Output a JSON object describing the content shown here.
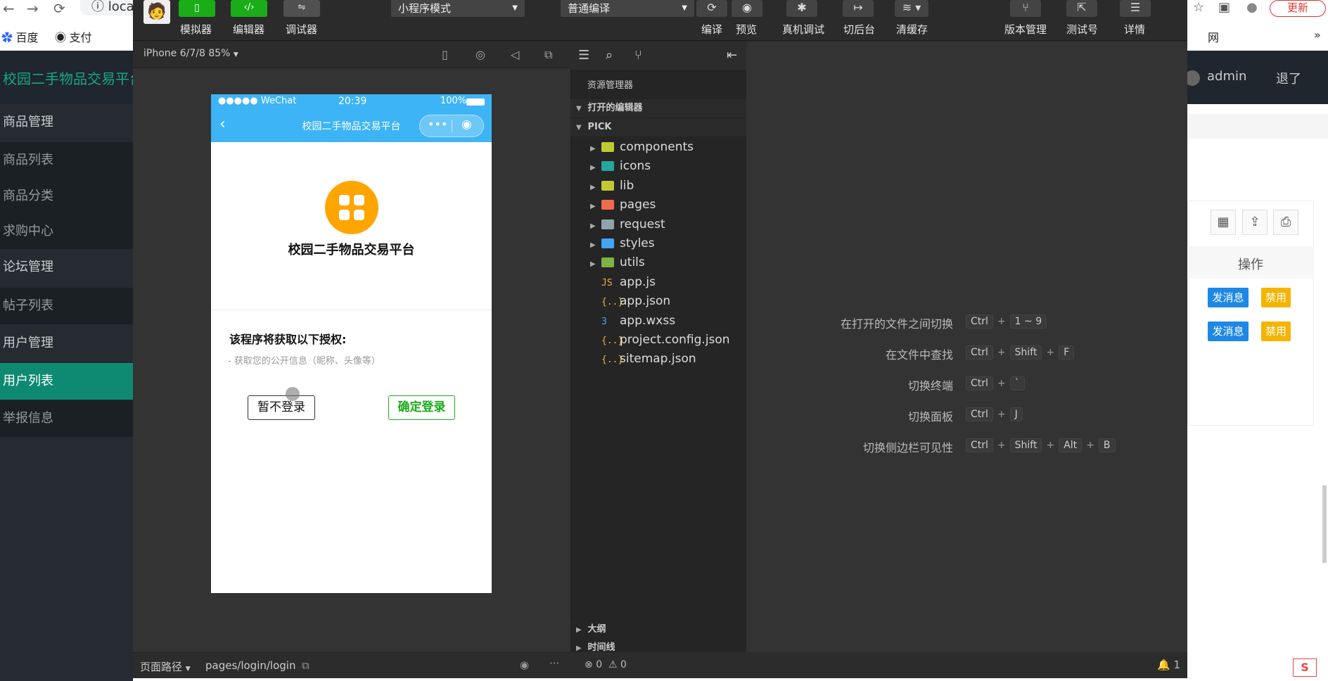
{
  "browser": {
    "url_text": "loca",
    "bookmarks": [
      "百度",
      "支付"
    ],
    "extension_text": "网",
    "update_label": "更新"
  },
  "admin": {
    "title": "校园二手物品交易平台",
    "user": "admin",
    "logout": "退了",
    "sidebar": [
      {
        "label": "商品管理",
        "kind": "group"
      },
      {
        "label": "商品列表",
        "kind": "sub"
      },
      {
        "label": "商品分类",
        "kind": "sub"
      },
      {
        "label": "求购中心",
        "kind": "sub"
      },
      {
        "label": "论坛管理",
        "kind": "group"
      },
      {
        "label": "帖子列表",
        "kind": "sub"
      },
      {
        "label": "用户管理",
        "kind": "group"
      },
      {
        "label": "用户列表",
        "kind": "active"
      },
      {
        "label": "举报信息",
        "kind": "sub"
      }
    ],
    "table_header_op": "操作",
    "row_actions": [
      {
        "msg": "发消息",
        "disable": "禁用"
      },
      {
        "msg": "发消息",
        "disable": "禁用"
      }
    ]
  },
  "toolbar": {
    "simulator": "模拟器",
    "editor": "编辑器",
    "debugger": "调试器",
    "mode_select": "小程序模式",
    "compile_select": "普通编译",
    "compile": "编译",
    "preview": "预览",
    "real_debug": "真机调试",
    "background": "切后台",
    "clear_cache": "清缓存",
    "version": "版本管理",
    "test_account": "测试号",
    "details": "详情"
  },
  "simulator": {
    "device": "iPhone 6/7/8 85%",
    "status_carrier": "●●●●● WeChat",
    "status_time": "20:39",
    "status_battery": "100%",
    "nav_title": "校园二手物品交易平台",
    "app_name": "校园二手物品交易平台",
    "auth_title": "该程序将获取以下授权:",
    "auth_item": "- 获取您的公开信息（昵称、头像等）",
    "cancel_btn": "暂不登录",
    "confirm_btn": "确定登录",
    "path_label": "页面路径",
    "path_value": "pages/login/login"
  },
  "explorer": {
    "title": "资源管理器",
    "open_editors": "打开的编辑器",
    "project": "PICK",
    "folders": [
      {
        "name": "components",
        "color": "#c0ca33"
      },
      {
        "name": "icons",
        "color": "#26a69a"
      },
      {
        "name": "lib",
        "color": "#c0ca33"
      },
      {
        "name": "pages",
        "color": "#ef6c4f"
      },
      {
        "name": "request",
        "color": "#90a4ae"
      },
      {
        "name": "styles",
        "color": "#42a5f5"
      },
      {
        "name": "utils",
        "color": "#7cb342"
      }
    ],
    "files": [
      {
        "name": "app.js",
        "icon": "JS"
      },
      {
        "name": "app.json",
        "icon": "{..}"
      },
      {
        "name": "app.wxss",
        "icon": "3"
      },
      {
        "name": "project.config.json",
        "icon": "{..}"
      },
      {
        "name": "sitemap.json",
        "icon": "{..}"
      }
    ],
    "outline": "大纲",
    "timeline": "时间线",
    "errors": "0",
    "warnings": "0"
  },
  "shortcuts": [
    {
      "label": "在打开的文件之间切换",
      "keys": [
        "Ctrl",
        "1 ~ 9"
      ]
    },
    {
      "label": "在文件中查找",
      "keys": [
        "Ctrl",
        "Shift",
        "F"
      ]
    },
    {
      "label": "切换终端",
      "keys": [
        "Ctrl",
        "`"
      ]
    },
    {
      "label": "切换面板",
      "keys": [
        "Ctrl",
        "J"
      ]
    },
    {
      "label": "切换侧边栏可见性",
      "keys": [
        "Ctrl",
        "Shift",
        "Alt",
        "B"
      ]
    }
  ],
  "editor_footer": {
    "notifications": "1"
  }
}
